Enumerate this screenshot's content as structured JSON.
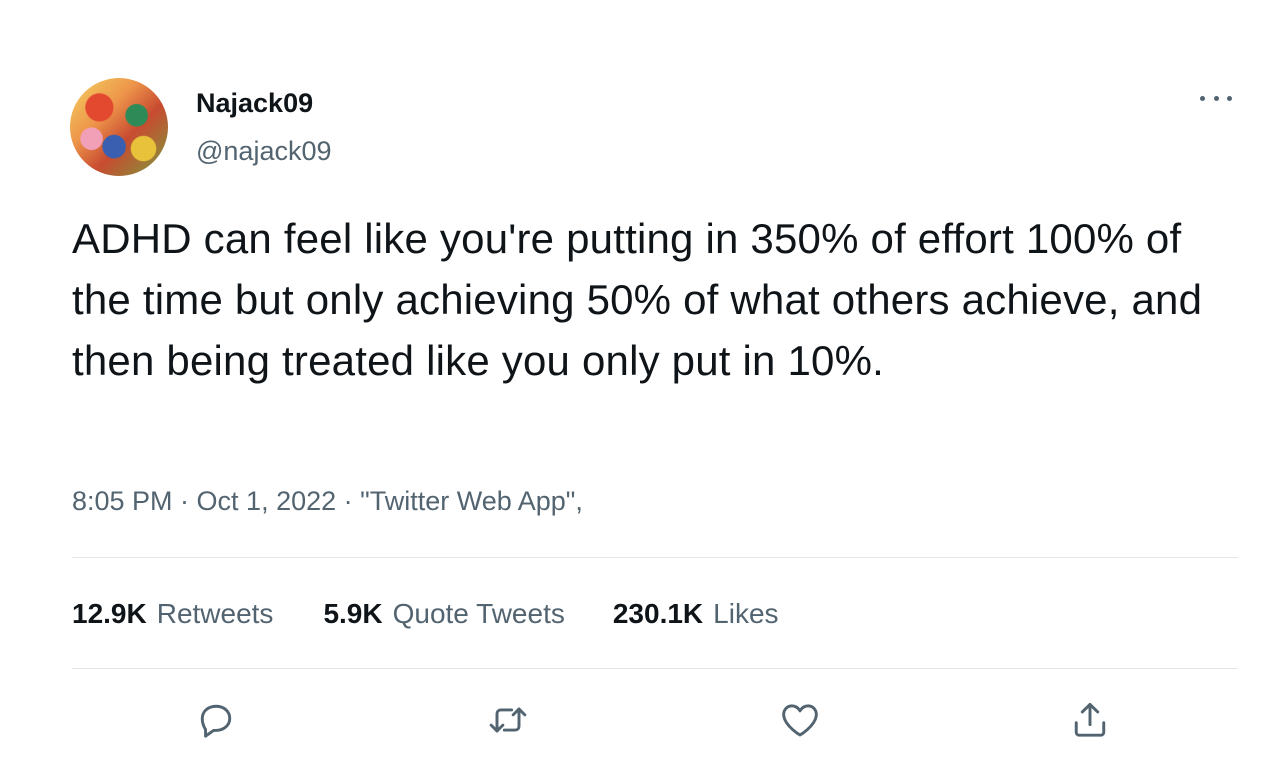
{
  "author": {
    "display_name": "Najack09",
    "handle": "@najack09"
  },
  "tweet": {
    "text": "ADHD can feel like you're putting in 350% of effort 100% of the time but only achieving 50% of what others achieve, and then being treated like you only put in 10%.",
    "meta": "8:05 PM · Oct 1, 2022 · \"Twitter Web App\","
  },
  "stats": {
    "retweets_count": "12.9K",
    "retweets_label": "Retweets",
    "quotes_count": "5.9K",
    "quotes_label": "Quote Tweets",
    "likes_count": "230.1K",
    "likes_label": "Likes"
  },
  "icons": {
    "more": "more-horizontal-icon",
    "reply": "reply-icon",
    "retweet": "retweet-icon",
    "like": "heart-icon",
    "share": "share-icon"
  },
  "colors": {
    "text_primary": "#0f1419",
    "text_secondary": "#536471",
    "divider": "#e1e6ea"
  }
}
